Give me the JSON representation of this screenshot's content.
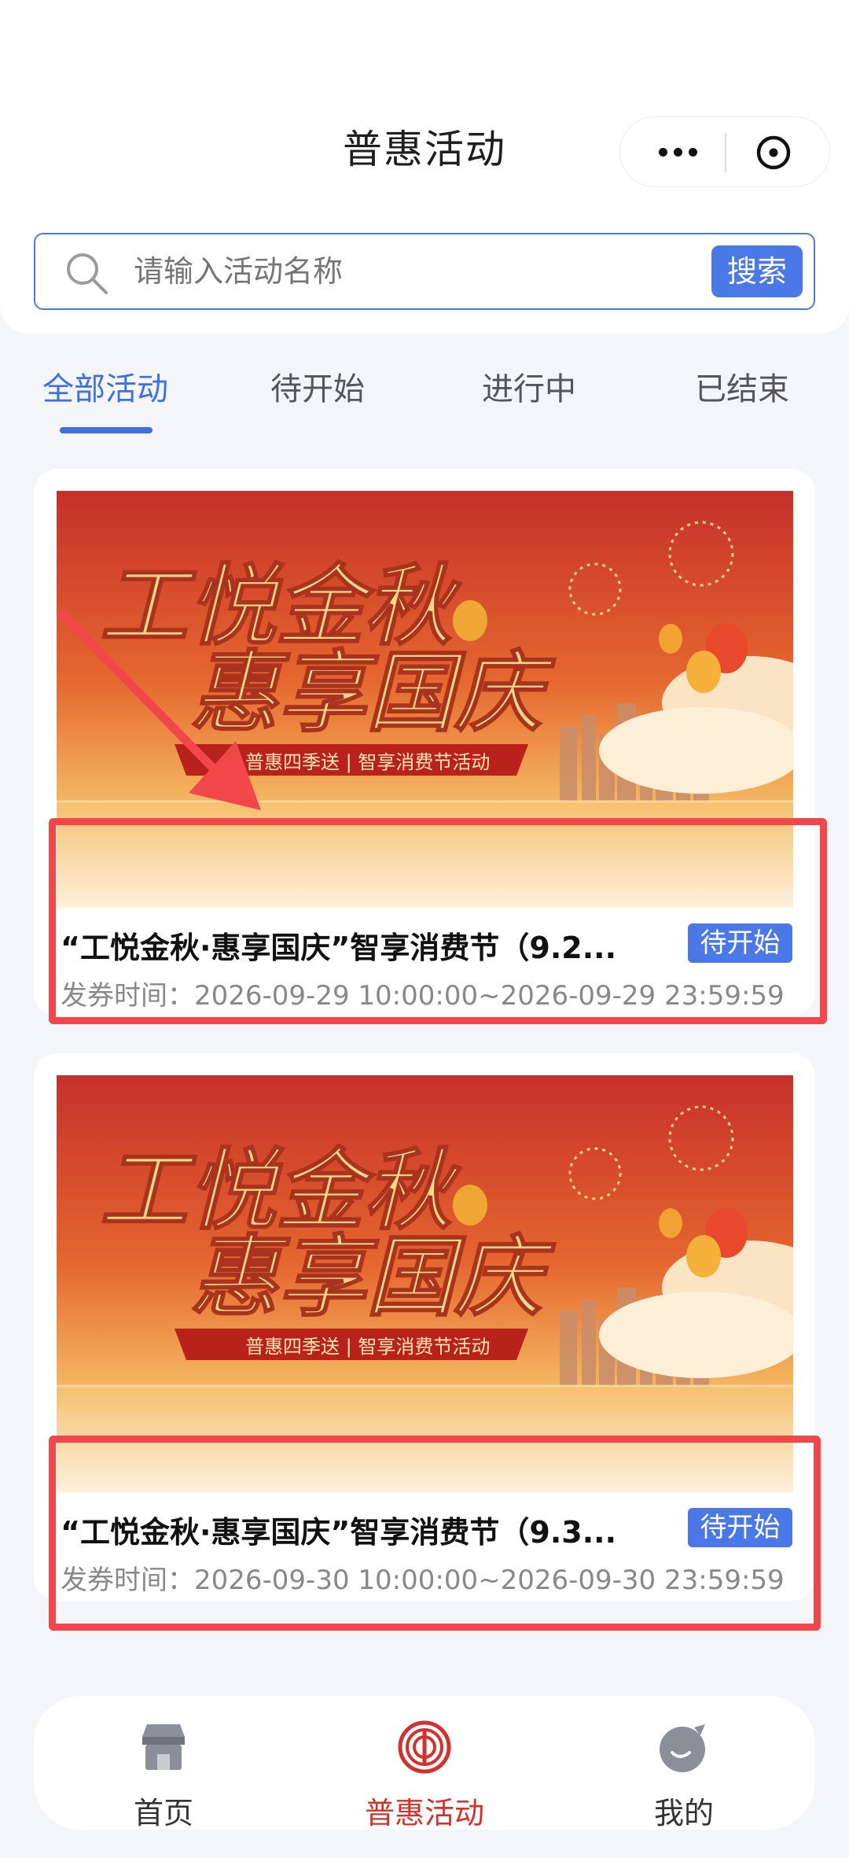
{
  "header": {
    "title": "普惠活动"
  },
  "search": {
    "placeholder": "请输入活动名称",
    "button_label": "搜索"
  },
  "tabs": [
    {
      "label": "全部活动",
      "active": true
    },
    {
      "label": "待开始",
      "active": false
    },
    {
      "label": "进行中",
      "active": false
    },
    {
      "label": "已结束",
      "active": false
    }
  ],
  "banner": {
    "headline_1": "工悦金秋",
    "headline_2": "惠享国庆",
    "ribbon": "普惠四季送 | 智享消费节活动"
  },
  "activities": [
    {
      "title": "“工悦金秋·惠享国庆”智享消费节（9.2...",
      "status": "待开始",
      "time": "发券时间：2026-09-29 10:00:00~2026-09-29 23:59:59"
    },
    {
      "title": "“工悦金秋·惠享国庆”智享消费节（9.3...",
      "status": "待开始",
      "time": "发券时间：2026-09-30 10:00:00~2026-09-30 23:59:59"
    }
  ],
  "bottom_nav": [
    {
      "label": "首页",
      "icon": "shop-icon",
      "active": false
    },
    {
      "label": "普惠活动",
      "icon": "union-emblem-icon",
      "active": true
    },
    {
      "label": "我的",
      "icon": "profile-icon",
      "active": false
    }
  ],
  "colors": {
    "accent": "#4a78e6",
    "highlight": "#f2474a",
    "nav_active": "#d2322d"
  }
}
